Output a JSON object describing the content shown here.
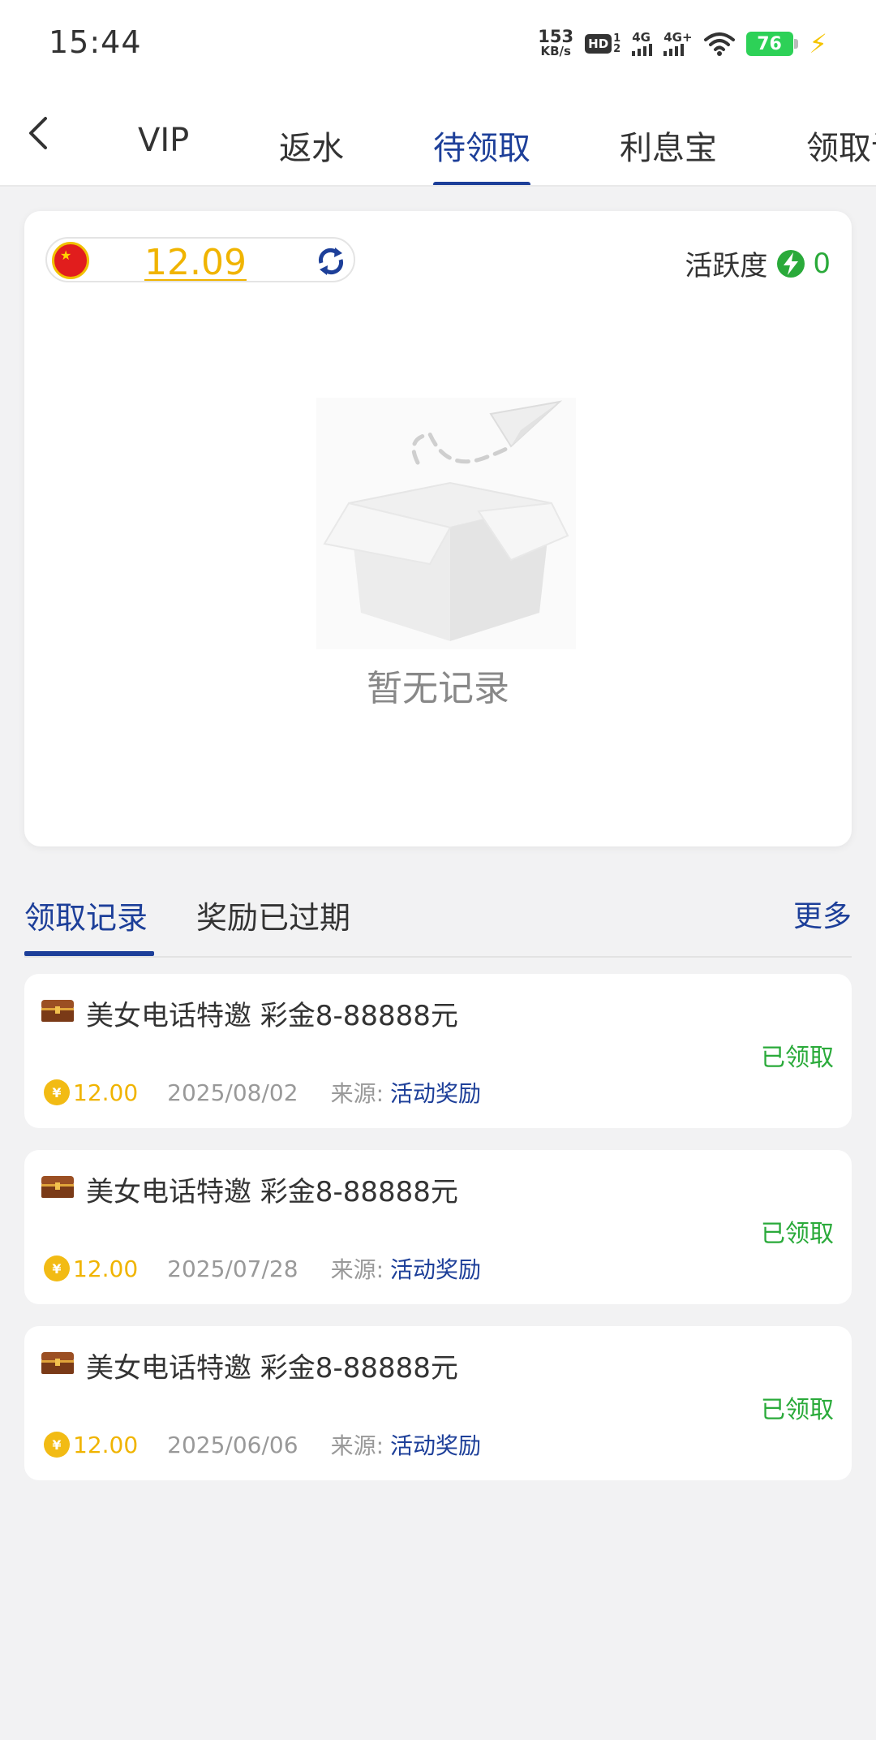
{
  "status_bar": {
    "time": "15:44",
    "net_speed": "153",
    "net_unit": "KB/s",
    "hd": "HD",
    "hd_sub_1": "1",
    "hd_sub_2": "2",
    "signal_1": "4G",
    "signal_2": "4G+",
    "battery": "76",
    "colors": {
      "battery": "#2dd157",
      "charging": "#f5c400"
    }
  },
  "nav": {
    "tabs": [
      {
        "label": "VIP"
      },
      {
        "label": "返水"
      },
      {
        "label": "待领取"
      },
      {
        "label": "利息宝"
      },
      {
        "label": "领取记"
      }
    ],
    "active_tab": "待领取",
    "accent_color": "#1d3f99"
  },
  "summary": {
    "balance": "12.09",
    "activity_label": "活跃度",
    "activity_value": "0",
    "empty_text": "暂无记录"
  },
  "record_tabs": {
    "tabs": [
      {
        "label": "领取记录"
      },
      {
        "label": "奖励已过期"
      }
    ],
    "more_label": "更多"
  },
  "records": [
    {
      "title": "美女电话特邀  彩金8-88888元",
      "status": "已领取",
      "amount": "12.00",
      "date": "2025/08/02",
      "source_label": "来源:",
      "source": "活动奖励"
    },
    {
      "title": "美女电话特邀  彩金8-88888元",
      "status": "已领取",
      "amount": "12.00",
      "date": "2025/07/28",
      "source_label": "来源:",
      "source": "活动奖励"
    },
    {
      "title": "美女电话特邀  彩金8-88888元",
      "status": "已领取",
      "amount": "12.00",
      "date": "2025/06/06",
      "source_label": "来源:",
      "source": "活动奖励"
    }
  ],
  "icons": {
    "coin_symbol": "¥",
    "names": [
      "back-arrow-icon",
      "china-flag-icon",
      "refresh-icon",
      "lightning-icon",
      "empty-box-icon",
      "treasure-chest-icon",
      "coin-icon"
    ]
  }
}
